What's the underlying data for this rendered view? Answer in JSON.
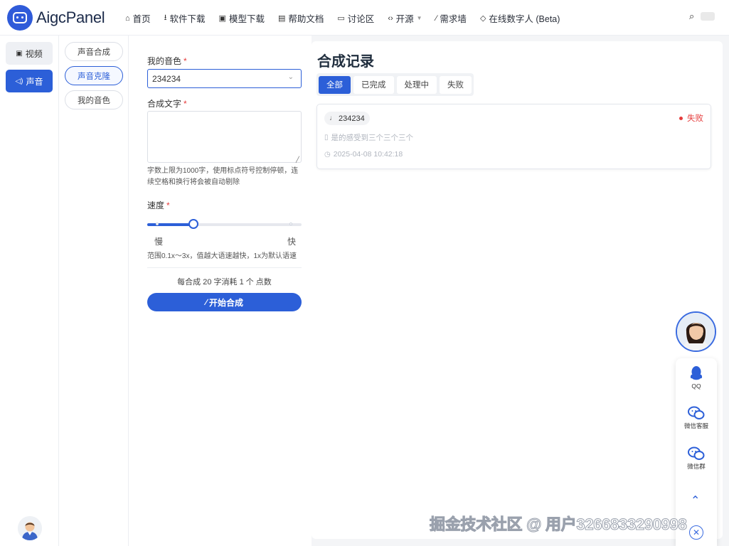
{
  "header": {
    "logo_text": "AigcPanel",
    "nav": [
      {
        "label": "首页",
        "icon": "home-icon"
      },
      {
        "label": "软件下载",
        "icon": "download-icon"
      },
      {
        "label": "模型下载",
        "icon": "cube-icon"
      },
      {
        "label": "帮助文档",
        "icon": "book-icon"
      },
      {
        "label": "讨论区",
        "icon": "chat-icon"
      },
      {
        "label": "开源",
        "icon": "code-icon"
      },
      {
        "label": "需求墙",
        "icon": "magic-wand-icon"
      },
      {
        "label": "在线数字人 (Beta)",
        "icon": "tag-icon"
      }
    ]
  },
  "sidebar": {
    "items": [
      {
        "label": "视频",
        "icon": "video-icon"
      },
      {
        "label": "声音",
        "icon": "sound-icon"
      }
    ]
  },
  "subnav": {
    "items": [
      "声音合成",
      "声音克隆",
      "我的音色"
    ],
    "active": "声音克隆"
  },
  "form": {
    "voice_label": "我的音色",
    "voice_value": "234234",
    "text_label": "合成文字",
    "text_value": "",
    "text_hint": "字数上限为1000字，使用标点符号控制停顿，连续空格和换行将会被自动剔除",
    "speed_label": "速度",
    "speed_min_label": "慢",
    "speed_max_label": "快",
    "speed_level": 0.3,
    "speed_hint": "范围0.1x～3x，值越大语速越快，1x为默认语速",
    "cost_text": "每合成 20 字消耗 1 个 点数",
    "submit_label": "开始合成"
  },
  "records": {
    "title": "合成记录",
    "tabs": [
      "全部",
      "已完成",
      "处理中",
      "失败"
    ],
    "active_tab": "全部",
    "items": [
      {
        "voice": "234234",
        "status": "失败",
        "text": "是的感受到三个三个三个",
        "time": "2025-04-08 10:42:18"
      }
    ]
  },
  "float": {
    "items": [
      {
        "label": "QQ",
        "icon": "qq-icon"
      },
      {
        "label": "微信客服",
        "icon": "wechat-icon"
      },
      {
        "label": "微信群",
        "icon": "wechat-icon"
      }
    ]
  },
  "watermark": "掘金技术社区 @ 用户3266833290998",
  "colors": {
    "primary": "#2c5fd8",
    "danger": "#e53b3b",
    "text": "#333333"
  }
}
